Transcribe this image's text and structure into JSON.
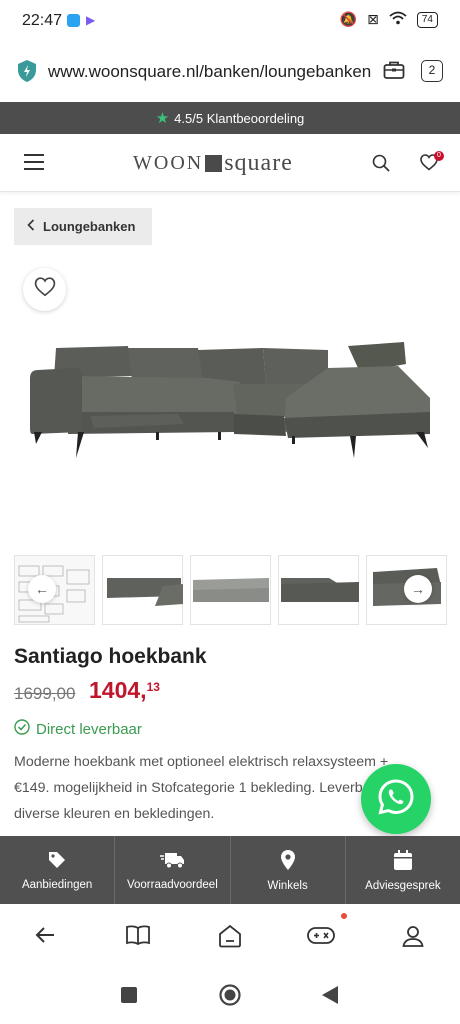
{
  "status_bar": {
    "time": "22:47",
    "battery": "74"
  },
  "browser": {
    "url": "www.woonsquare.nl/banken/loungebanken",
    "tab_count": "2"
  },
  "rating_bar": {
    "text": "4.5/5 Klantbeoordeling"
  },
  "header": {
    "logo_left": "WOON",
    "logo_right": "square",
    "wishlist_count": "0"
  },
  "breadcrumb": {
    "label": "Loungebanken"
  },
  "product": {
    "title": "Santiago hoekbank",
    "old_price": "1699,00",
    "price_main": "1404,",
    "price_cents": "13",
    "stock": "Direct leverbaar",
    "description": "Moderne hoekbank met optioneel elektrisch relaxsysteem + €149. mogelijkheid in Stofcategorie 1 bekleding. Leverbaar in diverse kleuren en bekledingen."
  },
  "site_nav": [
    {
      "label": "Aanbiedingen",
      "icon": "tag-icon"
    },
    {
      "label": "Voorraadvoordeel",
      "icon": "delivery-truck-icon"
    },
    {
      "label": "Winkels",
      "icon": "map-pin-icon"
    },
    {
      "label": "Adviesgesprek",
      "icon": "calendar-icon"
    }
  ],
  "colors": {
    "price": "#c0162c",
    "stock": "#3a9a4e",
    "nav_bg": "#505050",
    "rating_bg": "#4d4d4d",
    "whatsapp": "#25d366"
  }
}
